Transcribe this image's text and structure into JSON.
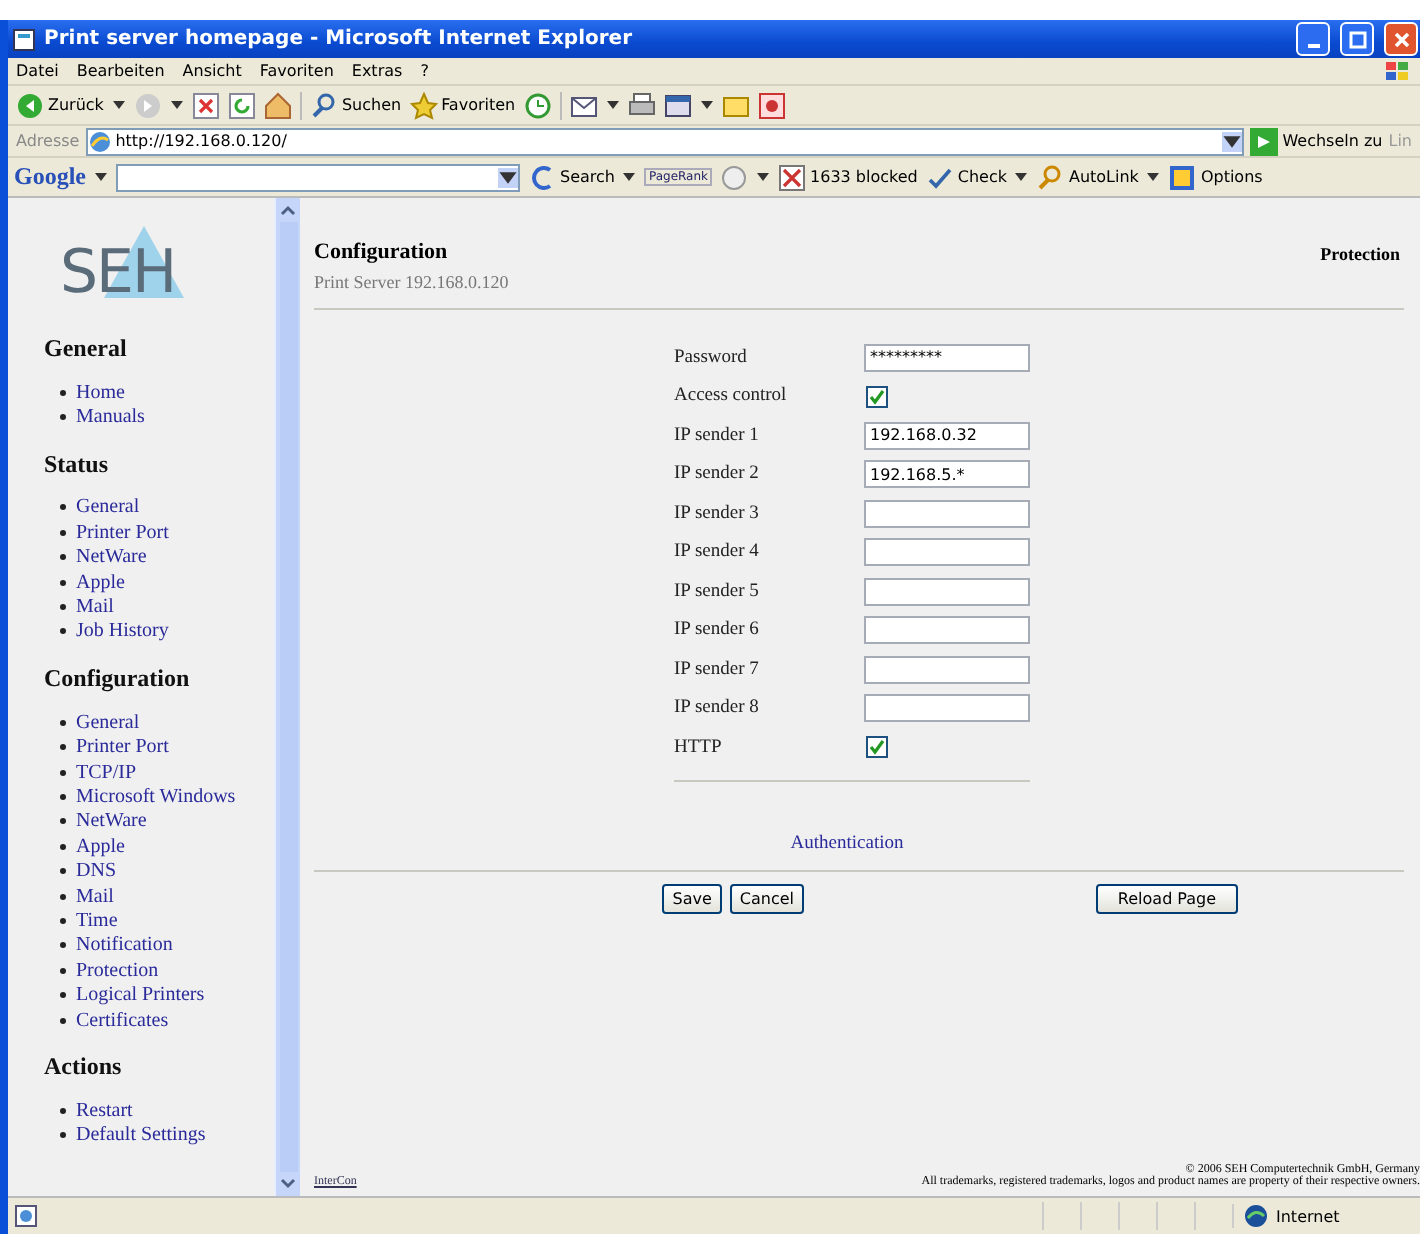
{
  "window": {
    "title": "Print server homepage - Microsoft Internet Explorer"
  },
  "menu": [
    "Datei",
    "Bearbeiten",
    "Ansicht",
    "Favoriten",
    "Extras",
    "?"
  ],
  "toolbar": {
    "back": "Zurück",
    "search": "Suchen",
    "favorites": "Favoriten"
  },
  "address": {
    "label": "Adresse",
    "value": "http://192.168.0.120/",
    "go": "Wechseln zu",
    "links": "Lin"
  },
  "google_bar": {
    "logo": "Google",
    "search": "Search",
    "pagerank": "PageRank",
    "blocked": "1633 blocked",
    "check": "Check",
    "autolink": "AutoLink",
    "options": "Options"
  },
  "sidebar": {
    "logo": "SEH",
    "sections": [
      {
        "title": "General",
        "items": [
          "Home",
          "Manuals"
        ]
      },
      {
        "title": "Status",
        "items": [
          "General",
          "Printer Port",
          "NetWare",
          "Apple",
          "Mail",
          "Job History"
        ]
      },
      {
        "title": "Configuration",
        "items": [
          "General",
          "Printer Port",
          "TCP/IP",
          "Microsoft Windows",
          "NetWare",
          "Apple",
          "DNS",
          "Mail",
          "Time",
          "Notification",
          "Protection",
          "Logical Printers",
          "Certificates"
        ]
      },
      {
        "title": "Actions",
        "items": [
          "Restart",
          "Default Settings"
        ]
      }
    ]
  },
  "header": {
    "title": "Configuration",
    "subtitle": "Print Server 192.168.0.120",
    "section": "Protection"
  },
  "form": [
    {
      "kind": "password",
      "label": "Password",
      "value": "*********"
    },
    {
      "kind": "checkbox",
      "label": "Access control",
      "checked": true
    },
    {
      "kind": "text",
      "label": "IP sender 1",
      "value": "192.168.0.32"
    },
    {
      "kind": "text",
      "label": "IP sender 2",
      "value": "192.168.5.*"
    },
    {
      "kind": "text",
      "label": "IP sender 3"
    },
    {
      "kind": "text",
      "label": "IP sender 4"
    },
    {
      "kind": "text",
      "label": "IP sender 5"
    },
    {
      "kind": "text",
      "label": "IP sender 6"
    },
    {
      "kind": "text",
      "label": "IP sender 7"
    },
    {
      "kind": "text",
      "label": "IP sender 8"
    },
    {
      "kind": "checkbox",
      "label": "HTTP",
      "checked": true
    }
  ],
  "link": "Authentication",
  "buttons": {
    "left": [
      "Save",
      "Cancel"
    ],
    "right": "Reload Page"
  },
  "footer": {
    "logo_link": "InterCon",
    "copyright": "© 2006 SEH Computertechnik GmbH, Germany",
    "trademarks": "All trademarks, registered trademarks, logos and product names are property of their respective owners."
  },
  "status_bar": {
    "zone": "Internet"
  }
}
